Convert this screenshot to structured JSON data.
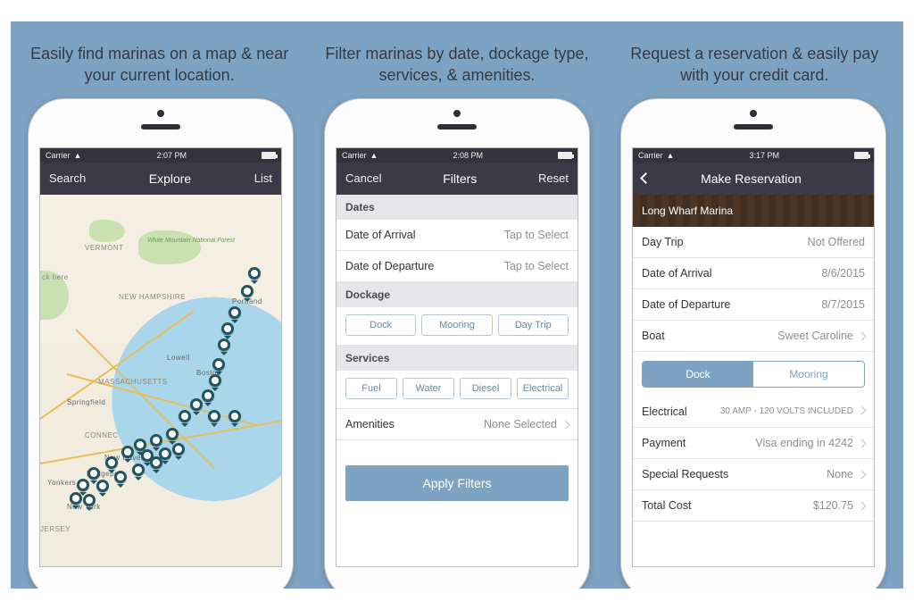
{
  "captions": {
    "c1": "Easily find marinas on a map & near your current location.",
    "c2": "Filter marinas by date, dockage type, services, & amenities.",
    "c3": "Request a reservation & easily pay with your credit card."
  },
  "phone1": {
    "status": {
      "carrier": "Carrier",
      "time": "2:07 PM"
    },
    "nav": {
      "left": "Search",
      "title": "Explore",
      "right": "List"
    },
    "map_labels": {
      "vermont": "VERMONT",
      "nh": "NEW HAMPSHIRE",
      "ma": "MASSACHUSETTS",
      "ct": "CONNEC",
      "jersey": "JERSEY",
      "newyork": "New York",
      "boston": "Boston",
      "portland": "Portland",
      "springfield": "Springfield",
      "lowell": "Lowell",
      "newhaven": "New Haven",
      "bridgeport": "Bridgeport",
      "yonkers": "Yonkers",
      "park1": "White Mountain National Forest",
      "ck_here": "ck here"
    }
  },
  "phone2": {
    "status": {
      "carrier": "Carrier",
      "time": "2:08 PM"
    },
    "nav": {
      "left": "Cancel",
      "title": "Filters",
      "right": "Reset"
    },
    "sections": {
      "dates": "Dates",
      "dockage": "Dockage",
      "services": "Services"
    },
    "rows": {
      "arrival_label": "Date of Arrival",
      "arrival_value": "Tap to Select",
      "departure_label": "Date of Departure",
      "departure_value": "Tap to Select",
      "amenities_label": "Amenities",
      "amenities_value": "None Selected"
    },
    "dockage_chips": {
      "a": "Dock",
      "b": "Mooring",
      "c": "Day Trip"
    },
    "service_chips": {
      "a": "Fuel",
      "b": "Water",
      "c": "Diesel",
      "d": "Electrical"
    },
    "apply": "Apply Filters"
  },
  "phone3": {
    "status": {
      "carrier": "Carrier",
      "time": "3:17 PM"
    },
    "nav": {
      "title": "Make Reservation"
    },
    "hero_title": "Long Wharf Marina",
    "rows": {
      "daytrip_label": "Day Trip",
      "daytrip_value": "Not Offered",
      "arrival_label": "Date of Arrival",
      "arrival_value": "8/6/2015",
      "departure_label": "Date of Departure",
      "departure_value": "8/7/2015",
      "boat_label": "Boat",
      "boat_value": "Sweet Caroline",
      "electrical_label": "Electrical",
      "electrical_value": "30 AMP - 120 VOLTS INCLUDED",
      "payment_label": "Payment",
      "payment_value": "Visa ending in 4242",
      "special_label": "Special Requests",
      "special_value": "None",
      "total_label": "Total Cost",
      "total_value": "$120.75"
    },
    "segment": {
      "dock": "Dock",
      "mooring": "Mooring"
    }
  }
}
